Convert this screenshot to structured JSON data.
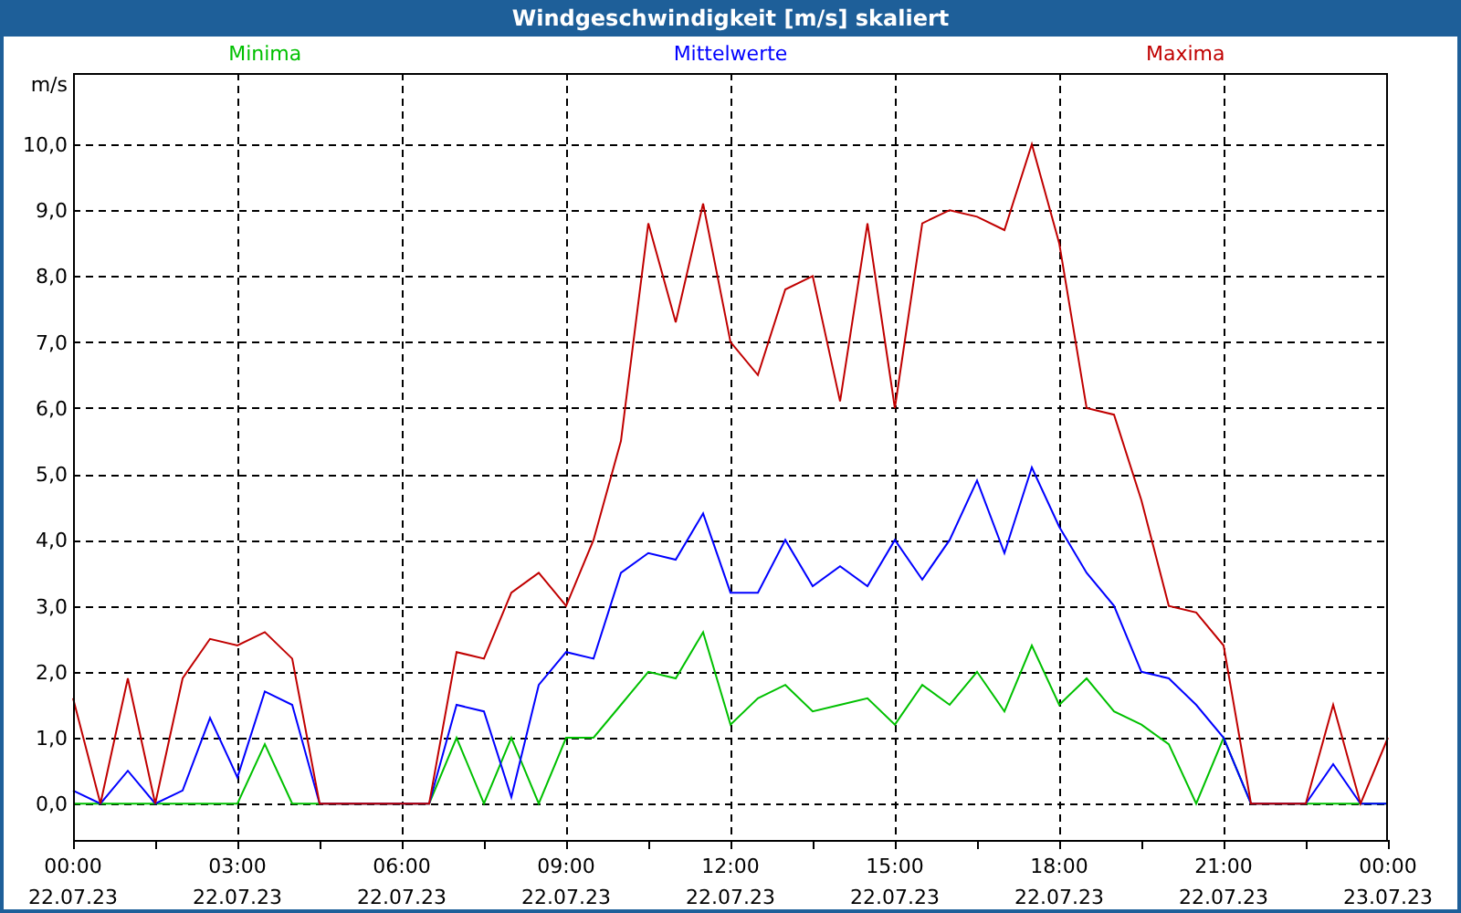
{
  "window": {
    "title": "Windgeschwindigkeit [m/s] skaliert"
  },
  "chart": {
    "chart_data": {
      "type": "line",
      "ylabel": "m/s",
      "categories": [
        "00:00 22.07.23",
        null,
        null,
        null,
        null,
        null,
        "03:00 22.07.23",
        null,
        null,
        null,
        null,
        null,
        "06:00 22.07.23",
        null,
        null,
        null,
        null,
        null,
        "09:00 22.07.23",
        null,
        null,
        null,
        null,
        null,
        "12:00 22.07.23",
        null,
        null,
        null,
        null,
        null,
        "15:00 22.07.23",
        null,
        null,
        null,
        null,
        null,
        "18:00 22.07.23",
        null,
        null,
        null,
        null,
        null,
        "21:00 22.07.23",
        null,
        null,
        null,
        null,
        null,
        "00:00 23.07.23"
      ],
      "series": [
        {
          "name": "Minima",
          "color": "#00c000",
          "values": [
            0,
            0,
            0,
            0,
            0,
            0,
            0,
            0.9,
            0,
            0,
            0,
            0,
            0,
            0,
            1.0,
            0,
            1.0,
            0,
            1.0,
            1.0,
            1.5,
            2.0,
            1.9,
            2.6,
            1.2,
            1.6,
            1.8,
            1.4,
            1.5,
            1.6,
            1.2,
            1.8,
            1.5,
            2.0,
            1.4,
            2.4,
            1.5,
            1.9,
            1.4,
            1.2,
            0.9,
            0,
            1.0,
            0,
            0,
            0,
            0,
            0,
            0
          ]
        },
        {
          "name": "Mittelwerte",
          "color": "#0000ff",
          "values": [
            0.2,
            0,
            0.5,
            0,
            0.2,
            1.3,
            0.4,
            1.7,
            1.5,
            0,
            0,
            0,
            0,
            0,
            1.5,
            1.4,
            0.1,
            1.8,
            2.3,
            2.2,
            3.5,
            3.8,
            3.7,
            4.4,
            3.2,
            3.2,
            4.0,
            3.3,
            3.6,
            3.3,
            4.0,
            3.4,
            4.0,
            4.9,
            3.8,
            5.1,
            4.2,
            3.5,
            3.0,
            2.0,
            1.9,
            1.5,
            1.0,
            0,
            0,
            0,
            0.6,
            0,
            0
          ]
        },
        {
          "name": "Maxima",
          "color": "#c00000",
          "values": [
            1.6,
            0,
            1.9,
            0,
            1.9,
            2.5,
            2.4,
            2.6,
            2.2,
            0,
            0,
            0,
            0,
            0,
            2.3,
            2.2,
            3.2,
            3.5,
            3.0,
            4.0,
            5.5,
            8.8,
            7.3,
            9.1,
            7.0,
            6.5,
            7.8,
            8.0,
            6.1,
            8.8,
            6.0,
            8.8,
            9.0,
            8.9,
            8.7,
            10.0,
            8.5,
            6.0,
            5.9,
            4.6,
            3.0,
            2.9,
            2.4,
            0,
            0,
            0,
            1.5,
            0,
            1.0
          ]
        }
      ],
      "ylim": [
        -0.55,
        11.08
      ],
      "grid": true,
      "yticks": [
        {
          "value": 0,
          "label": "0,0"
        },
        {
          "value": 1,
          "label": "1,0"
        },
        {
          "value": 2,
          "label": "2,0"
        },
        {
          "value": 3,
          "label": "3,0"
        },
        {
          "value": 4,
          "label": "4,0"
        },
        {
          "value": 5,
          "label": "5,0"
        },
        {
          "value": 6,
          "label": "6,0"
        },
        {
          "value": 7,
          "label": "7,0"
        },
        {
          "value": 8,
          "label": "8,0"
        },
        {
          "value": 9,
          "label": "9,0"
        },
        {
          "value": 10,
          "label": "10,0"
        }
      ]
    }
  }
}
